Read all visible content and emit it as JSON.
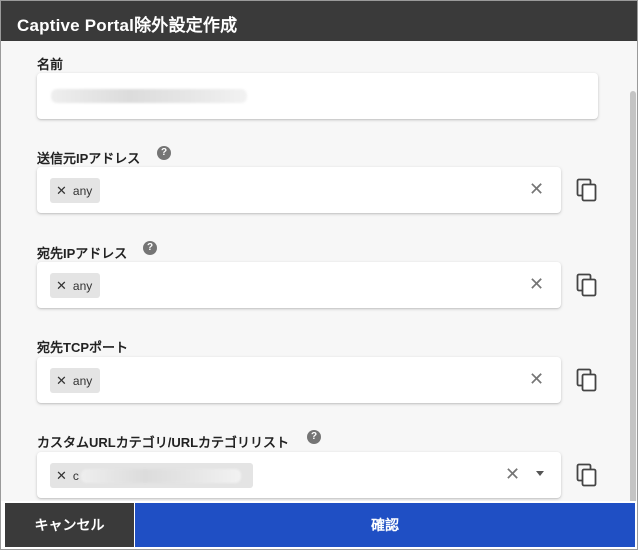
{
  "dialog": {
    "title": "Captive Portal除外設定作成"
  },
  "fields": {
    "name": {
      "label": "名前",
      "value_redacted": true
    },
    "source_ip": {
      "label": "送信元IPアドレス",
      "help": "?",
      "chip_remove": "✕",
      "chip": "any",
      "clear": "✕"
    },
    "dest_ip": {
      "label": "宛先IPアドレス",
      "help": "?",
      "chip_remove": "✕",
      "chip": "any",
      "clear": "✕"
    },
    "dest_tcp_port": {
      "label": "宛先TCPポート",
      "chip_remove": "✕",
      "chip": "any",
      "clear": "✕"
    },
    "url_category": {
      "label": "カスタムURLカテゴリ/URLカテゴリリスト",
      "help": "?",
      "chip_remove": "✕",
      "chip_text": "c",
      "clear": "✕"
    }
  },
  "footer": {
    "cancel_label": "キャンセル",
    "confirm_label": "確認"
  },
  "colors": {
    "titlebar": "#3a3a3a",
    "confirm_button": "#1f4fc4",
    "cancel_button": "#3a3a3a",
    "chip_bg": "#e4e4e4"
  },
  "icons": {
    "copy": "copy-icon",
    "help": "help-icon",
    "clear": "clear-icon",
    "dropdown": "chevron-down-icon"
  }
}
